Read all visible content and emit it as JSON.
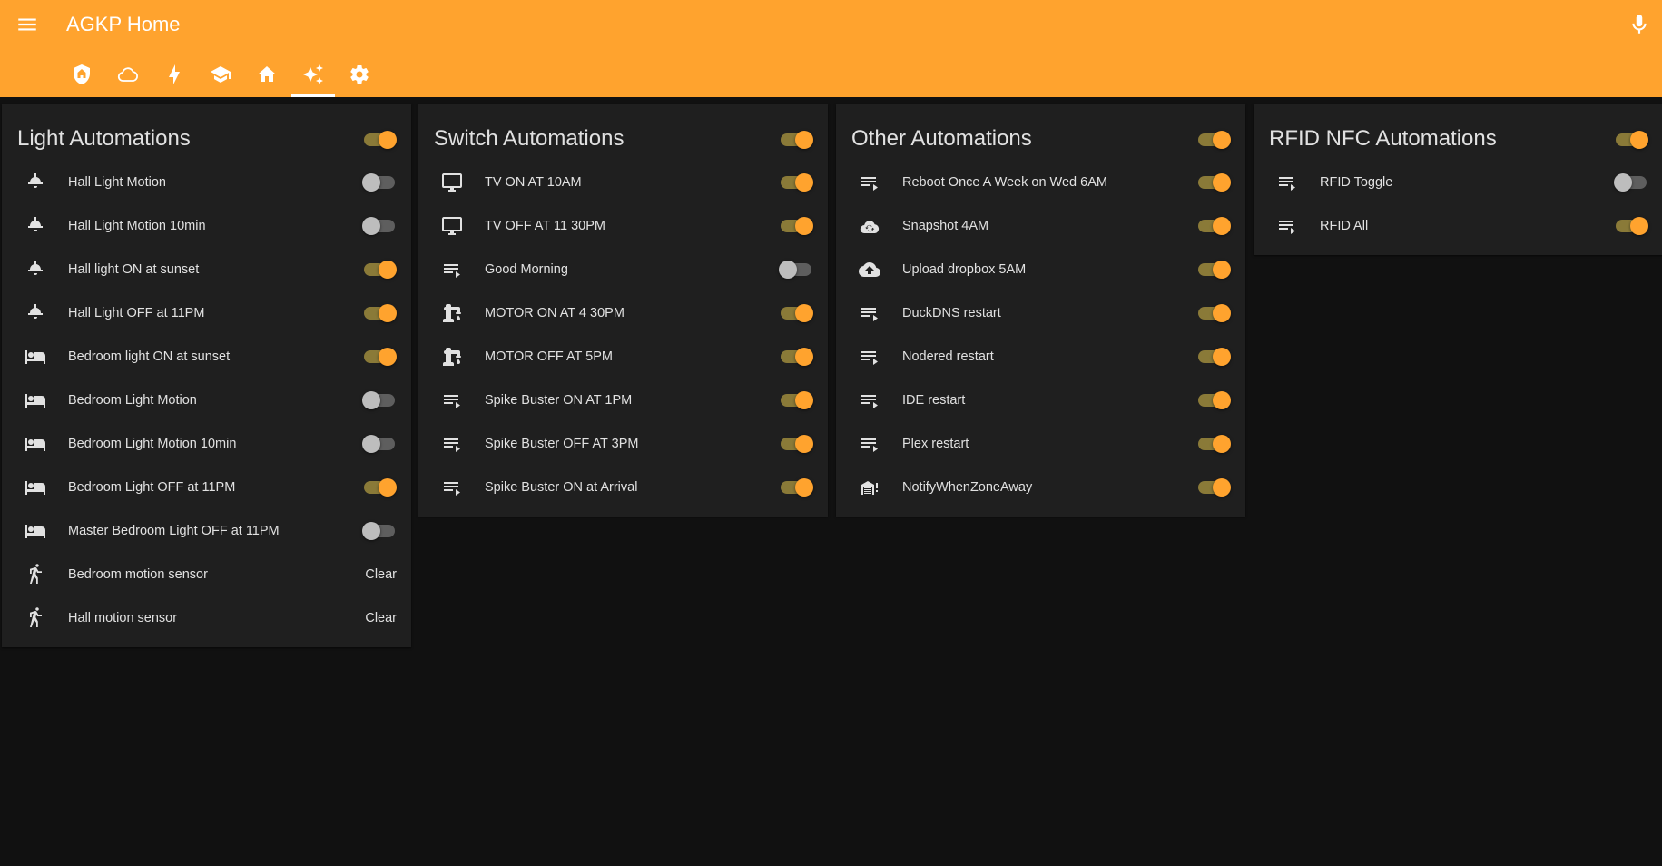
{
  "app": {
    "title": "AGKP Home",
    "accent_color": "#ffa32e",
    "background_color": "#111111",
    "card_color": "#1f1f1f",
    "header_icons": {
      "menu": "menu-icon",
      "mic": "microphone-icon"
    },
    "tabs": [
      {
        "icon": "home-assistant-shield-icon",
        "active": false
      },
      {
        "icon": "cloud-icon",
        "active": false
      },
      {
        "icon": "lightning-bolt-icon",
        "active": false
      },
      {
        "icon": "school-icon",
        "active": false
      },
      {
        "icon": "home-icon",
        "active": false
      },
      {
        "icon": "auto-fix-sparkles-icon",
        "active": true
      },
      {
        "icon": "cog-icon",
        "active": false
      }
    ]
  },
  "cards": [
    {
      "title": "Light Automations",
      "header_toggle_on": true,
      "rows": [
        {
          "icon": "ceiling-light-icon",
          "label": "Hall Light Motion",
          "type": "toggle",
          "on": false
        },
        {
          "icon": "ceiling-light-icon",
          "label": "Hall Light Motion 10min",
          "type": "toggle",
          "on": false
        },
        {
          "icon": "ceiling-light-icon",
          "label": "Hall light ON at sunset",
          "type": "toggle",
          "on": true
        },
        {
          "icon": "ceiling-light-icon",
          "label": "Hall Light OFF at 11PM",
          "type": "toggle",
          "on": true
        },
        {
          "icon": "bed-icon",
          "label": "Bedroom light ON at sunset",
          "type": "toggle",
          "on": true
        },
        {
          "icon": "bed-icon",
          "label": "Bedroom Light Motion",
          "type": "toggle",
          "on": false
        },
        {
          "icon": "bed-icon",
          "label": "Bedroom Light Motion 10min",
          "type": "toggle",
          "on": false
        },
        {
          "icon": "bed-icon",
          "label": "Bedroom Light OFF at 11PM",
          "type": "toggle",
          "on": true
        },
        {
          "icon": "bed-icon",
          "label": "Master Bedroom Light OFF at 11PM",
          "type": "toggle",
          "on": false
        },
        {
          "icon": "walk-icon",
          "label": "Bedroom motion sensor",
          "type": "state",
          "state": "Clear"
        },
        {
          "icon": "walk-icon",
          "label": "Hall motion sensor",
          "type": "state",
          "state": "Clear"
        }
      ]
    },
    {
      "title": "Switch Automations",
      "header_toggle_on": true,
      "rows": [
        {
          "icon": "monitor-icon",
          "label": "TV ON AT 10AM",
          "type": "toggle",
          "on": true
        },
        {
          "icon": "monitor-icon",
          "label": "TV OFF AT 11 30PM",
          "type": "toggle",
          "on": true
        },
        {
          "icon": "playlist-play-icon",
          "label": "Good Morning",
          "type": "toggle",
          "on": false
        },
        {
          "icon": "water-pump-icon",
          "label": "MOTOR ON AT 4 30PM",
          "type": "toggle",
          "on": true
        },
        {
          "icon": "water-pump-icon",
          "label": "MOTOR OFF AT 5PM",
          "type": "toggle",
          "on": true
        },
        {
          "icon": "playlist-play-icon",
          "label": "Spike Buster ON AT 1PM",
          "type": "toggle",
          "on": true
        },
        {
          "icon": "playlist-play-icon",
          "label": "Spike Buster OFF AT 3PM",
          "type": "toggle",
          "on": true
        },
        {
          "icon": "playlist-play-icon",
          "label": "Spike Buster ON at Arrival",
          "type": "toggle",
          "on": true
        }
      ]
    },
    {
      "title": "Other Automations",
      "header_toggle_on": true,
      "rows": [
        {
          "icon": "playlist-play-icon",
          "label": "Reboot Once A Week on Wed 6AM",
          "type": "toggle",
          "on": true
        },
        {
          "icon": "cloud-sync-icon",
          "label": "Snapshot 4AM",
          "type": "toggle",
          "on": true
        },
        {
          "icon": "cloud-upload-icon",
          "label": "Upload dropbox 5AM",
          "type": "toggle",
          "on": true
        },
        {
          "icon": "playlist-play-icon",
          "label": "DuckDNS restart",
          "type": "toggle",
          "on": true
        },
        {
          "icon": "playlist-play-icon",
          "label": "Nodered restart",
          "type": "toggle",
          "on": true
        },
        {
          "icon": "playlist-play-icon",
          "label": "IDE restart",
          "type": "toggle",
          "on": true
        },
        {
          "icon": "playlist-play-icon",
          "label": "Plex restart",
          "type": "toggle",
          "on": true
        },
        {
          "icon": "garage-alert-icon",
          "label": "NotifyWhenZoneAway",
          "type": "toggle",
          "on": true
        }
      ]
    },
    {
      "title": "RFID NFC Automations",
      "header_toggle_on": true,
      "rows": [
        {
          "icon": "playlist-play-icon",
          "label": "RFID Toggle",
          "type": "toggle",
          "on": false
        },
        {
          "icon": "playlist-play-icon",
          "label": "RFID All",
          "type": "toggle",
          "on": true
        }
      ]
    }
  ]
}
